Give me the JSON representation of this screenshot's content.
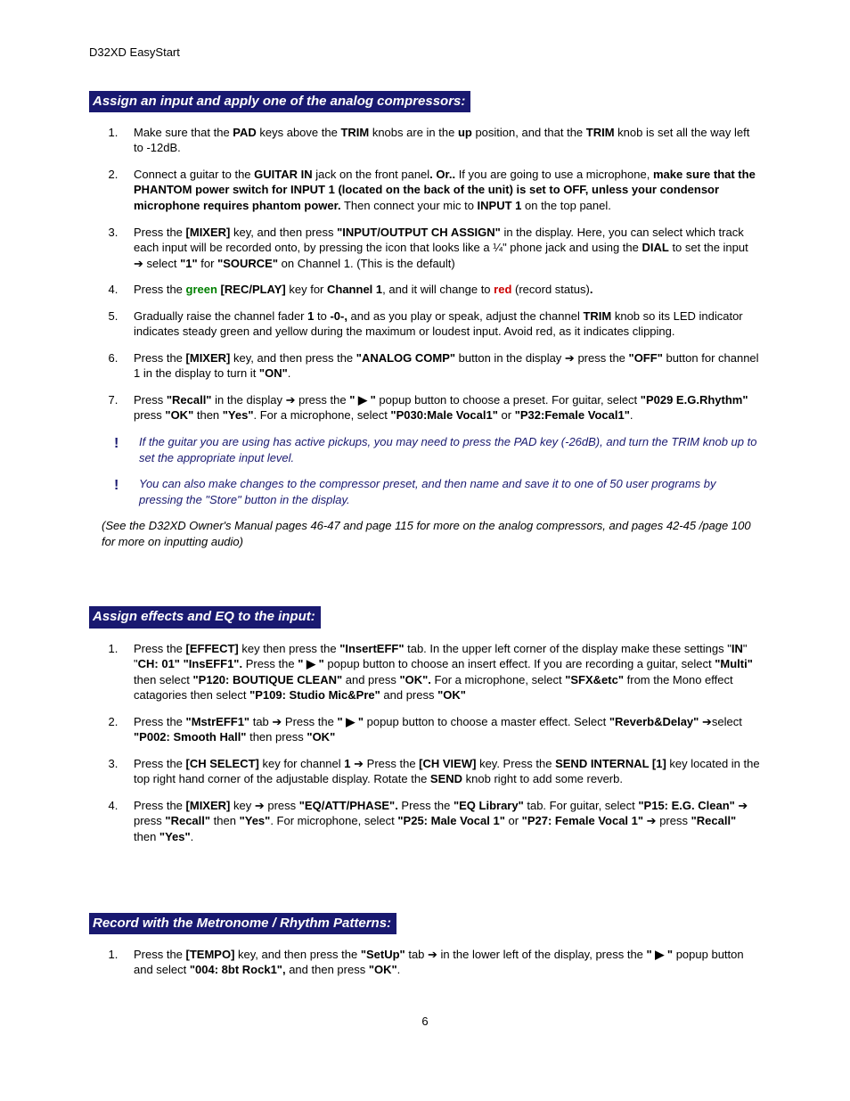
{
  "header": "D32XD EasyStart",
  "page_number": "6",
  "sections": {
    "s1": {
      "heading": " Assign an input and apply one of the analog compressors: ",
      "items": {
        "i1": {
          "t1": "Make sure that the ",
          "b1": "PAD",
          "t2": " keys above the ",
          "b2": "TRIM",
          "t3": " knobs are in the ",
          "b3": "up",
          "t4": " position, and that the ",
          "b4": "TRIM",
          "t5": " knob is set all the way left to -12dB."
        },
        "i2": {
          "t1": "Connect a guitar to the ",
          "b1": "GUITAR IN",
          "t2": " jack on the front panel",
          "b2": ". Or..",
          "t3": " If you are going to use a microphone, ",
          "b3": "make sure that the PHANTOM power switch for INPUT 1 (located on the back of the unit) is set to OFF, unless your condensor microphone requires phantom power.",
          "t4": " Then connect your mic to ",
          "b4": "INPUT 1",
          "t5": " on the top panel."
        },
        "i3": {
          "t1": "Press the ",
          "b1": "[MIXER]",
          "t2": " key, and then press ",
          "b2": "\"INPUT/OUTPUT CH ASSIGN\"",
          "t3": " in the display. Here, you can select which track each input will be recorded onto, by pressing the icon that looks like a ¼\" phone jack and using the ",
          "b3": "DIAL",
          "t4": " to set the input ",
          "arrow": "➔",
          "t5": " select ",
          "b4": "\"1\"",
          "t6": " for ",
          "b5": "\"SOURCE\"",
          "t7": " on Channel 1. (This is the default)"
        },
        "i4": {
          "t1": "Press the ",
          "g1": "green",
          "b1": " [REC/PLAY]",
          "t2": " key for ",
          "b2": "Channel 1",
          "t3": ", and it will change to ",
          "r1": "red",
          "t4": " (record status)",
          "b3": "."
        },
        "i5": {
          "t1": "Gradually raise the channel fader ",
          "b1": "1",
          "t2": " to  ",
          "b2": "-0-,",
          "t3": " and as you play or speak, adjust the channel ",
          "b3": "TRIM",
          "t4": " knob so its LED indicator indicates steady green and yellow during the maximum or loudest input. Avoid red, as it indicates clipping."
        },
        "i6": {
          "t1": "Press the ",
          "b1": "[MIXER]",
          "t2": " key, and then press the ",
          "b2": "\"ANALOG COMP\"",
          "t3": " button in the display ",
          "arrow": "➔",
          "t4": " press the ",
          "b3": "\"OFF\"",
          "t5": " button for channel 1 in the display to turn it ",
          "b4": "\"ON\"",
          "t6": "."
        },
        "i7": {
          "t1": "Press ",
          "b1": "\"Recall\"",
          "t2": " in the display ",
          "arrow1": "➔",
          "t3": " press the ",
          "b2": "\" ▶ \"",
          "t4": " popup button to choose a preset. For guitar, select ",
          "b3": "\"P029 E.G.Rhythm\"",
          "t5": " press ",
          "b4": "\"OK\"",
          "t6": " then ",
          "b5": "\"Yes\"",
          "t7": ". For a microphone, select ",
          "b6": "\"P030:Male Vocal1\"",
          "t8": " or ",
          "b7": "\"P32:Female Vocal1\"",
          "t9": "."
        }
      },
      "note1": "If the guitar you are using has active pickups, you may need to press the PAD key (-26dB), and turn the TRIM knob up to set the appropriate input level.",
      "note2": "You can also make changes to the compressor preset, and then name and save it to one of 50 user programs by pressing the \"Store\" button in the display.",
      "manual_ref": "(See the D32XD Owner's Manual pages 46-47 and page 115 for more on the analog compressors, and pages 42-45 /page 100 for more on inputting audio)"
    },
    "s2": {
      "heading": " Assign effects and EQ to the input: ",
      "items": {
        "i1": {
          "t1": "Press the ",
          "b1": "[EFFECT]",
          "t2": " key then press the ",
          "b2": "\"InsertEFF\"",
          "t3": " tab. In the upper left corner of the display make these settings \"",
          "b3": "IN",
          "t4": "\" \"",
          "b4": "CH: 01\"  \"InsEFF1\".",
          "t5": " Press the ",
          "b5": "\" ▶ \"",
          "t6": " popup button to choose an insert effect. If you are recording a guitar, select ",
          "b6": "\"Multi\"",
          "t7": " then select ",
          "b7": "\"P120: BOUTIQUE CLEAN\"",
          "t8": "  and press ",
          "b8": "\"OK\".",
          "t9": "  For a microphone, select ",
          "b9": "\"SFX&etc\"",
          "t10": " from the Mono effect catagories then select ",
          "b10": "\"P109: Studio Mic&Pre\"",
          "t11": " and press ",
          "b11": "\"OK\""
        },
        "i2": {
          "t1": "Press the ",
          "b1": "\"MstrEFF1\"",
          "t2": " tab ",
          "arrow1": "➔",
          "t3": " Press the ",
          "b2": "\" ▶ \"",
          "t4": " popup button to choose a master effect. Select ",
          "b3": "\"Reverb&Delay\"",
          "t4b": " ",
          "arrow2": "➔",
          "t5": "select ",
          "b4": "\"P002: Smooth Hall\"",
          "t6": " then press ",
          "b5": "\"OK\""
        },
        "i3": {
          "t1": "Press the ",
          "b1": "[CH SELECT]",
          "t2": " key for channel ",
          "b2": "1",
          "t3": " ",
          "arrow1": "➔",
          "t4": " Press the ",
          "b3": "[CH VIEW]",
          "t5": " key. Press the ",
          "b4": "SEND INTERNAL [1]",
          "t6": " key located in the top right hand corner of the adjustable display. Rotate the ",
          "b5": "SEND",
          "t7": " knob right to add some reverb."
        },
        "i4": {
          "t1": "Press the ",
          "b1": "[MIXER]",
          "t2": " key ",
          "arrow1": "➔",
          "t3": " press ",
          "b2": "\"EQ/ATT/PHASE\".",
          "t4": " Press the ",
          "b3": "\"EQ Library\"",
          "t5": " tab. For guitar,  select ",
          "b4": "\"P15: E.G. Clean\"",
          "t6": " ",
          "arrow2": "➔",
          "t7": " press ",
          "b5": "\"Recall\"",
          "t8": " then ",
          "b6": "\"Yes\"",
          "t9": ". For microphone, select ",
          "b7": "\"P25: Male Vocal 1\"",
          "t10": " or ",
          "b8": "\"P27: Female Vocal 1\"",
          "t11": " ",
          "arrow3": "➔",
          "t12": " press ",
          "b9": "\"Recall\"",
          "t13": " then ",
          "b10": "\"Yes\"",
          "t14": "."
        }
      }
    },
    "s3": {
      "heading": " Record with the Metronome / Rhythm Patterns: ",
      "items": {
        "i1": {
          "t1": "Press the ",
          "b1": "[TEMPO]",
          "t2": " key, and then press the ",
          "b2": "\"SetUp\"",
          "t3": " tab ",
          "arrow1": "➔",
          "t4": " in the lower left of the display, press the ",
          "b3": "\" ▶ \"",
          "t5": " popup button and select ",
          "b4": "\"004: 8bt Rock1\",",
          "t6": " and then press ",
          "b5": "\"OK\"",
          "t7": "."
        }
      }
    }
  }
}
